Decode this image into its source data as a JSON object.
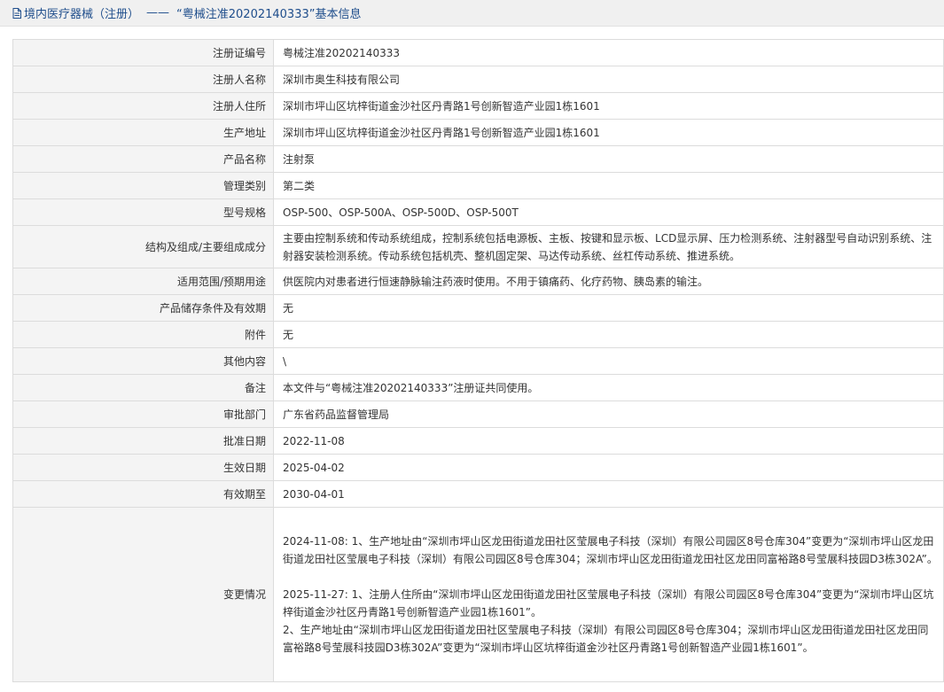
{
  "header": {
    "category": "境内医疗器械（注册）",
    "separator": "——",
    "title": "“粤械注准20202140333”基本信息"
  },
  "rows": [
    {
      "label": "注册证编号",
      "value": "粤械注准20202140333"
    },
    {
      "label": "注册人名称",
      "value": "深圳市奥生科技有限公司"
    },
    {
      "label": "注册人住所",
      "value": "深圳市坪山区坑梓街道金沙社区丹青路1号创新智造产业园1栋1601"
    },
    {
      "label": "生产地址",
      "value": "深圳市坪山区坑梓街道金沙社区丹青路1号创新智造产业园1栋1601"
    },
    {
      "label": "产品名称",
      "value": "注射泵"
    },
    {
      "label": "管理类别",
      "value": "第二类"
    },
    {
      "label": "型号规格",
      "value": "OSP-500、OSP-500A、OSP-500D、OSP-500T"
    },
    {
      "label": "结构及组成/主要组成成分",
      "value": "主要由控制系统和传动系统组成，控制系统包括电源板、主板、按键和显示板、LCD显示屏、压力检测系统、注射器型号自动识别系统、注射器安装检测系统。传动系统包括机壳、整机固定架、马达传动系统、丝杠传动系统、推进系统。"
    },
    {
      "label": "适用范围/预期用途",
      "value": "供医院内对患者进行恒速静脉输注药液时使用。不用于镇痛药、化疗药物、胰岛素的输注。"
    },
    {
      "label": "产品储存条件及有效期",
      "value": "无"
    },
    {
      "label": "附件",
      "value": "无"
    },
    {
      "label": "其他内容",
      "value": "\\"
    },
    {
      "label": "备注",
      "value": "本文件与“粤械注准20202140333”注册证共同使用。"
    },
    {
      "label": "审批部门",
      "value": "广东省药品监督管理局"
    },
    {
      "label": "批准日期",
      "value": "2022-11-08"
    },
    {
      "label": "生效日期",
      "value": "2025-04-02"
    },
    {
      "label": "有效期至",
      "value": "2030-04-01"
    }
  ],
  "changes": {
    "label": "变更情况",
    "entry1": "2024-11-08: 1、生产地址由“深圳市坪山区龙田街道龙田社区莹展电子科技（深圳）有限公司园区8号仓库304”变更为“深圳市坪山区龙田街道龙田社区莹展电子科技（深圳）有限公司园区8号仓库304；深圳市坪山区龙田街道龙田社区龙田同富裕路8号莹展科技园D3栋302A”。",
    "entry2_line1": "2025-11-27: 1、注册人住所由“深圳市坪山区龙田街道龙田社区莹展电子科技（深圳）有限公司园区8号仓库304”变更为“深圳市坪山区坑梓街道金沙社区丹青路1号创新智造产业园1栋1601”。",
    "entry2_line2": "2、生产地址由“深圳市坪山区龙田街道龙田社区莹展电子科技（深圳）有限公司园区8号仓库304；深圳市坪山区龙田街道龙田社区龙田同富裕路8号莹展科技园D3栋302A”变更为“深圳市坪山区坑梓街道金沙社区丹青路1号创新智造产业园1栋1601”。"
  }
}
